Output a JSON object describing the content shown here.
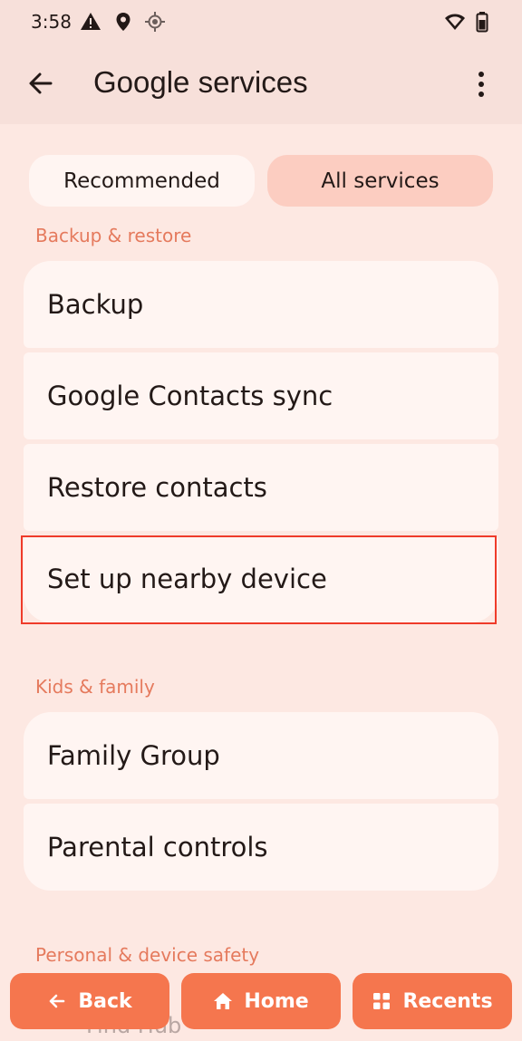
{
  "status_bar": {
    "time": "3:58",
    "icons": [
      "warning-icon",
      "location-pin-icon",
      "gps-icon",
      "wifi-icon",
      "battery-icon"
    ]
  },
  "app_bar": {
    "title": "Google services",
    "back_icon": "back-arrow-icon",
    "menu_icon": "more-vert-icon"
  },
  "tabs": [
    {
      "label": "Recommended",
      "selected": false
    },
    {
      "label": "All services",
      "selected": true
    }
  ],
  "sections": [
    {
      "header": "Backup & restore",
      "items": [
        "Backup",
        "Google Contacts sync",
        "Restore contacts",
        "Set up nearby device"
      ]
    },
    {
      "header": "Kids & family",
      "items": [
        "Family Group",
        "Parental controls"
      ]
    },
    {
      "header": "Personal & device safety",
      "items": [
        "Find Hub"
      ]
    }
  ],
  "nav": {
    "back": "Back",
    "home": "Home",
    "recents": "Recents"
  },
  "colors": {
    "background": "#fde8e2",
    "accent": "#f5764e",
    "section_header": "#e57a5d",
    "card": "#fff5f2",
    "selected_tab": "#fccdc1",
    "highlight": "#ef3b2a"
  }
}
